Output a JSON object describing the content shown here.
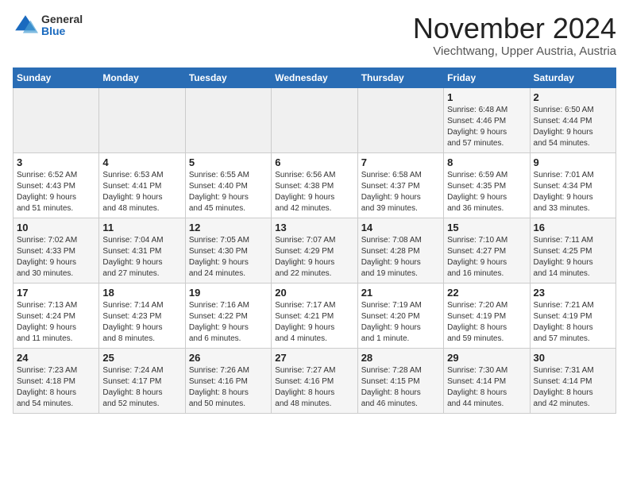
{
  "logo": {
    "general": "General",
    "blue": "Blue"
  },
  "title": "November 2024",
  "location": "Viechtwang, Upper Austria, Austria",
  "weekdays": [
    "Sunday",
    "Monday",
    "Tuesday",
    "Wednesday",
    "Thursday",
    "Friday",
    "Saturday"
  ],
  "weeks": [
    [
      {
        "day": "",
        "info": ""
      },
      {
        "day": "",
        "info": ""
      },
      {
        "day": "",
        "info": ""
      },
      {
        "day": "",
        "info": ""
      },
      {
        "day": "",
        "info": ""
      },
      {
        "day": "1",
        "info": "Sunrise: 6:48 AM\nSunset: 4:46 PM\nDaylight: 9 hours\nand 57 minutes."
      },
      {
        "day": "2",
        "info": "Sunrise: 6:50 AM\nSunset: 4:44 PM\nDaylight: 9 hours\nand 54 minutes."
      }
    ],
    [
      {
        "day": "3",
        "info": "Sunrise: 6:52 AM\nSunset: 4:43 PM\nDaylight: 9 hours\nand 51 minutes."
      },
      {
        "day": "4",
        "info": "Sunrise: 6:53 AM\nSunset: 4:41 PM\nDaylight: 9 hours\nand 48 minutes."
      },
      {
        "day": "5",
        "info": "Sunrise: 6:55 AM\nSunset: 4:40 PM\nDaylight: 9 hours\nand 45 minutes."
      },
      {
        "day": "6",
        "info": "Sunrise: 6:56 AM\nSunset: 4:38 PM\nDaylight: 9 hours\nand 42 minutes."
      },
      {
        "day": "7",
        "info": "Sunrise: 6:58 AM\nSunset: 4:37 PM\nDaylight: 9 hours\nand 39 minutes."
      },
      {
        "day": "8",
        "info": "Sunrise: 6:59 AM\nSunset: 4:35 PM\nDaylight: 9 hours\nand 36 minutes."
      },
      {
        "day": "9",
        "info": "Sunrise: 7:01 AM\nSunset: 4:34 PM\nDaylight: 9 hours\nand 33 minutes."
      }
    ],
    [
      {
        "day": "10",
        "info": "Sunrise: 7:02 AM\nSunset: 4:33 PM\nDaylight: 9 hours\nand 30 minutes."
      },
      {
        "day": "11",
        "info": "Sunrise: 7:04 AM\nSunset: 4:31 PM\nDaylight: 9 hours\nand 27 minutes."
      },
      {
        "day": "12",
        "info": "Sunrise: 7:05 AM\nSunset: 4:30 PM\nDaylight: 9 hours\nand 24 minutes."
      },
      {
        "day": "13",
        "info": "Sunrise: 7:07 AM\nSunset: 4:29 PM\nDaylight: 9 hours\nand 22 minutes."
      },
      {
        "day": "14",
        "info": "Sunrise: 7:08 AM\nSunset: 4:28 PM\nDaylight: 9 hours\nand 19 minutes."
      },
      {
        "day": "15",
        "info": "Sunrise: 7:10 AM\nSunset: 4:27 PM\nDaylight: 9 hours\nand 16 minutes."
      },
      {
        "day": "16",
        "info": "Sunrise: 7:11 AM\nSunset: 4:25 PM\nDaylight: 9 hours\nand 14 minutes."
      }
    ],
    [
      {
        "day": "17",
        "info": "Sunrise: 7:13 AM\nSunset: 4:24 PM\nDaylight: 9 hours\nand 11 minutes."
      },
      {
        "day": "18",
        "info": "Sunrise: 7:14 AM\nSunset: 4:23 PM\nDaylight: 9 hours\nand 8 minutes."
      },
      {
        "day": "19",
        "info": "Sunrise: 7:16 AM\nSunset: 4:22 PM\nDaylight: 9 hours\nand 6 minutes."
      },
      {
        "day": "20",
        "info": "Sunrise: 7:17 AM\nSunset: 4:21 PM\nDaylight: 9 hours\nand 4 minutes."
      },
      {
        "day": "21",
        "info": "Sunrise: 7:19 AM\nSunset: 4:20 PM\nDaylight: 9 hours\nand 1 minute."
      },
      {
        "day": "22",
        "info": "Sunrise: 7:20 AM\nSunset: 4:19 PM\nDaylight: 8 hours\nand 59 minutes."
      },
      {
        "day": "23",
        "info": "Sunrise: 7:21 AM\nSunset: 4:19 PM\nDaylight: 8 hours\nand 57 minutes."
      }
    ],
    [
      {
        "day": "24",
        "info": "Sunrise: 7:23 AM\nSunset: 4:18 PM\nDaylight: 8 hours\nand 54 minutes."
      },
      {
        "day": "25",
        "info": "Sunrise: 7:24 AM\nSunset: 4:17 PM\nDaylight: 8 hours\nand 52 minutes."
      },
      {
        "day": "26",
        "info": "Sunrise: 7:26 AM\nSunset: 4:16 PM\nDaylight: 8 hours\nand 50 minutes."
      },
      {
        "day": "27",
        "info": "Sunrise: 7:27 AM\nSunset: 4:16 PM\nDaylight: 8 hours\nand 48 minutes."
      },
      {
        "day": "28",
        "info": "Sunrise: 7:28 AM\nSunset: 4:15 PM\nDaylight: 8 hours\nand 46 minutes."
      },
      {
        "day": "29",
        "info": "Sunrise: 7:30 AM\nSunset: 4:14 PM\nDaylight: 8 hours\nand 44 minutes."
      },
      {
        "day": "30",
        "info": "Sunrise: 7:31 AM\nSunset: 4:14 PM\nDaylight: 8 hours\nand 42 minutes."
      }
    ]
  ]
}
